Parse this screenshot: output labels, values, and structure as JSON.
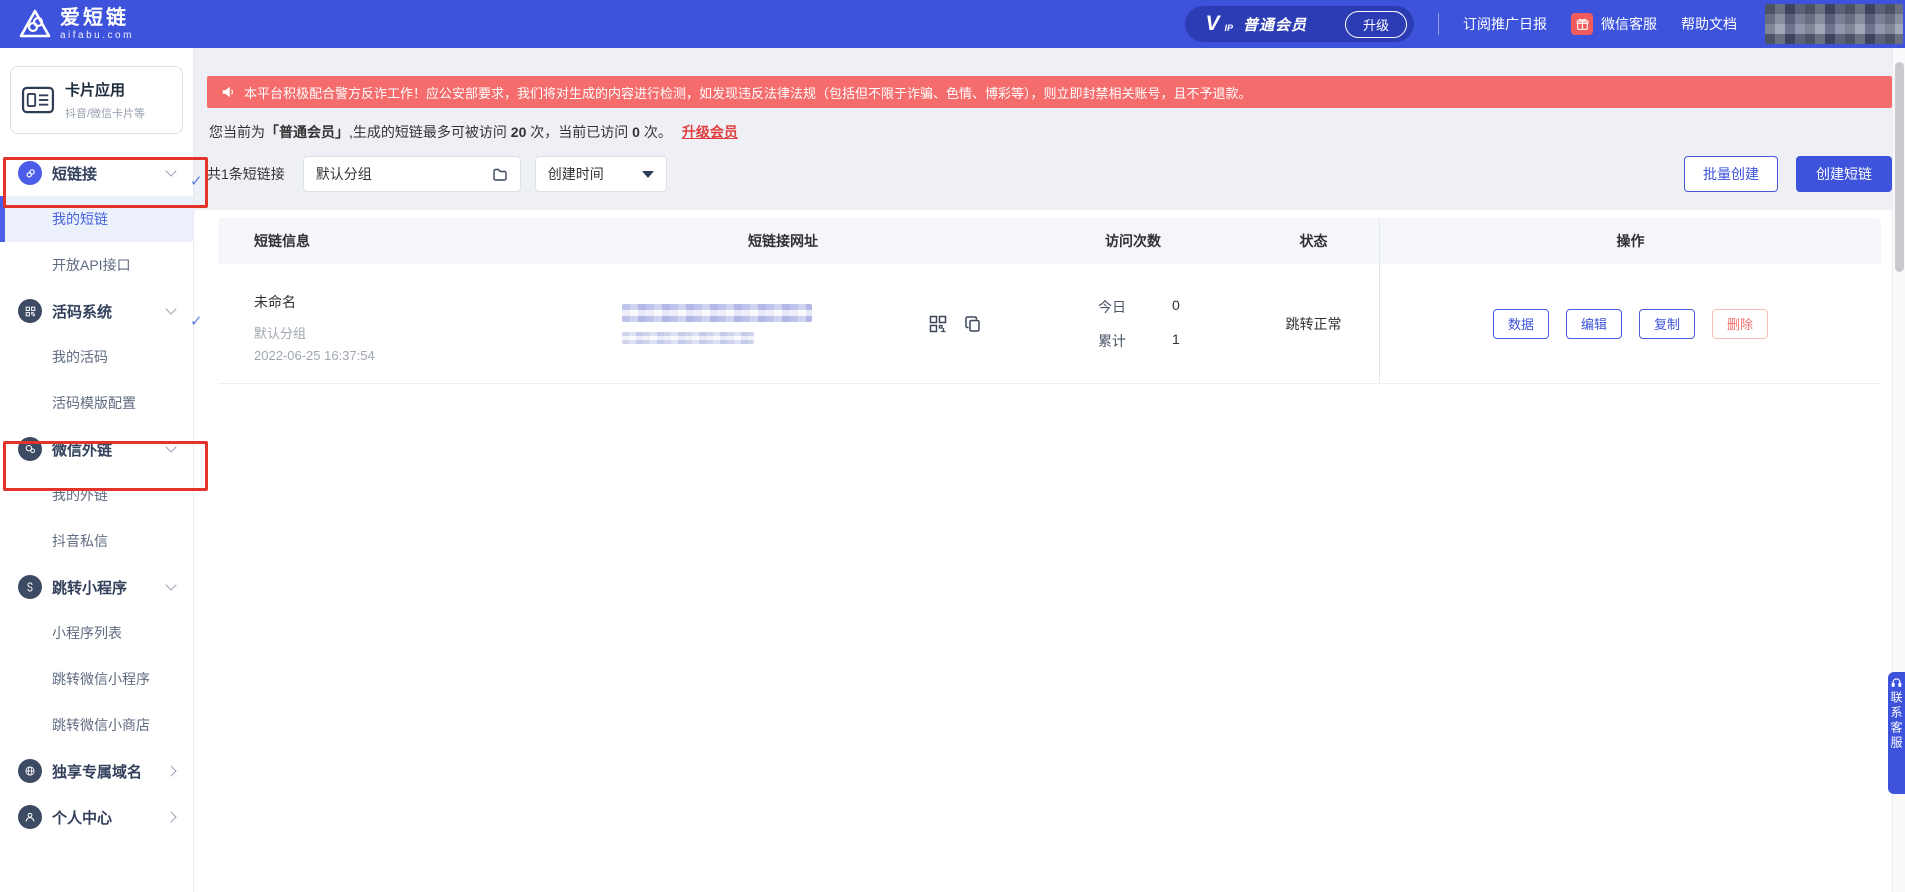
{
  "brand": {
    "name": "爱短链",
    "domain": "aifabu.com"
  },
  "header": {
    "vip_prefix": "V",
    "vip_prefix_small": "IP",
    "vip_label": "普通会员",
    "upgrade_button": "升级",
    "nav": [
      {
        "label": "订阅推广日报"
      },
      {
        "label": "微信客服",
        "icon": "gift-icon"
      },
      {
        "label": "帮助文档"
      }
    ]
  },
  "sidebar": {
    "card": {
      "title": "卡片应用",
      "subtitle": "抖音/微信卡片等",
      "icon": "card-icon"
    },
    "menu": [
      {
        "label": "短链接",
        "icon": "link-icon"
      },
      {
        "label": "我的短链"
      },
      {
        "label": "开放API接口"
      },
      {
        "label": "活码系统",
        "icon": "qrcode-icon"
      },
      {
        "label": "我的活码"
      },
      {
        "label": "活码模版配置"
      },
      {
        "label": "微信外链",
        "icon": "wechat-icon"
      },
      {
        "label": "我的外链"
      },
      {
        "label": "抖音私信"
      },
      {
        "label": "跳转小程序",
        "icon": "miniprogram-icon"
      },
      {
        "label": "小程序列表"
      },
      {
        "label": "跳转微信小程序"
      },
      {
        "label": "跳转微信小商店"
      },
      {
        "label": "独享专属域名",
        "icon": "globe-icon"
      },
      {
        "label": "个人中心",
        "icon": "user-icon"
      }
    ]
  },
  "notice": {
    "icon": "megaphone-icon",
    "text": "本平台积极配合警方反诈工作！应公安部要求，我们将对生成的内容进行检测，如发现违反法律法规（包括但不限于诈骗、色情、博彩等），则立即封禁相关账号，且不予退款。"
  },
  "member_note": {
    "t1": "您当前为",
    "t2": "「普通会员」",
    "t3": ",生成的短链最多可被访问 ",
    "t4": "20",
    "t5": " 次，当前已访问 ",
    "t6": "0",
    "t7": " 次。",
    "link": "升级会员"
  },
  "toolbar": {
    "count": "共1条短链接",
    "group_filter": "默认分组",
    "time_filter": "创建时间",
    "batch_button": "批量创建",
    "create_button": "创建短链"
  },
  "table": {
    "headers": [
      "短链信息",
      "短链接网址",
      "访问次数",
      "状态",
      "操作"
    ],
    "rows": [
      {
        "name": "未命名",
        "group": "默认分组",
        "created": "2022-06-25 16:37:54",
        "today_label": "今日",
        "today_value": "0",
        "total_label": "累计",
        "total_value": "1",
        "status": "跳转正常",
        "actions": [
          "数据",
          "编辑",
          "复制",
          "删除"
        ]
      }
    ]
  },
  "contact_widget": {
    "label": "联系客服",
    "icon": "headset-icon"
  },
  "colors": {
    "header_bg": "#3D53DB",
    "vip_pill_bg": "#2B3CB4",
    "accent_blue": "#3D53DB",
    "banner_red": "#F56C6C",
    "link_red": "#E03E3E",
    "gift_red": "#F25B5B",
    "active_item_bg": "#EDF1FB",
    "table_head_bg": "#F5F6FA",
    "annotation_red": "#E3342B"
  }
}
